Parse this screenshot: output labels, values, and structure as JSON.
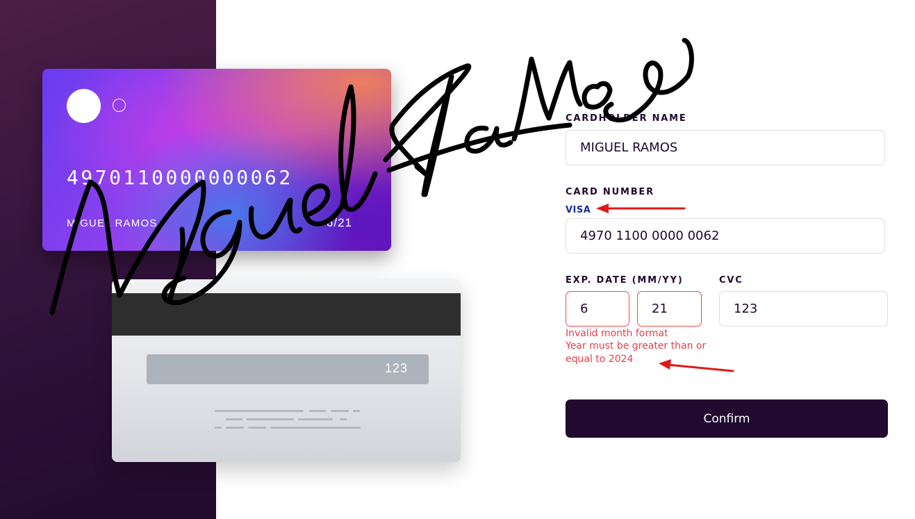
{
  "card_front": {
    "number": "4970110000000062",
    "name": "MIGUEL RAMOS",
    "expiry": "6/21"
  },
  "card_back": {
    "cvc": "123"
  },
  "form": {
    "cardholder_label": "CARDHOLDER NAME",
    "cardholder_value": "MIGUEL RAMOS",
    "card_number_label": "CARD NUMBER",
    "card_brand": "VISA",
    "card_number_value": "4970 1100 0000 0062",
    "exp_label": "EXP. DATE (MM/YY)",
    "exp_month": "6",
    "exp_year": "21",
    "cvc_label": "CVC",
    "cvc_value": "123",
    "errors": {
      "month": "Invalid month format",
      "year": "Year must be greater than or equal to 2024"
    },
    "confirm_label": "Confirm"
  },
  "annotations": {
    "signature": "Miguel Ramos",
    "arrow_color": "#e01818"
  },
  "colors": {
    "dark_purple": "#21092f",
    "error": "#e5404a",
    "brand_blue": "#1a2e9a"
  }
}
